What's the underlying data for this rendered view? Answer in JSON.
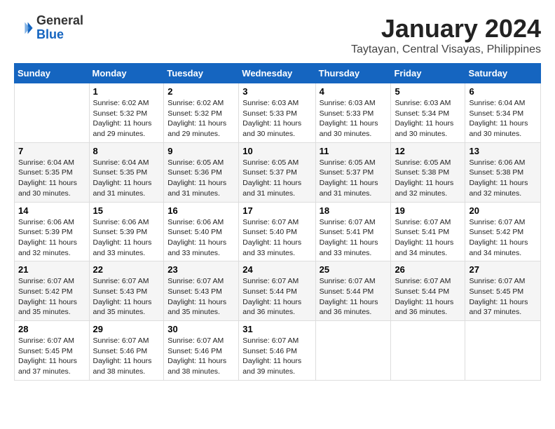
{
  "header": {
    "logo_general": "General",
    "logo_blue": "Blue",
    "month_title": "January 2024",
    "location": "Taytayan, Central Visayas, Philippines"
  },
  "days_of_week": [
    "Sunday",
    "Monday",
    "Tuesday",
    "Wednesday",
    "Thursday",
    "Friday",
    "Saturday"
  ],
  "weeks": [
    [
      {
        "day": "",
        "sunrise": "",
        "sunset": "",
        "daylight": ""
      },
      {
        "day": "1",
        "sunrise": "Sunrise: 6:02 AM",
        "sunset": "Sunset: 5:32 PM",
        "daylight": "Daylight: 11 hours and 29 minutes."
      },
      {
        "day": "2",
        "sunrise": "Sunrise: 6:02 AM",
        "sunset": "Sunset: 5:32 PM",
        "daylight": "Daylight: 11 hours and 29 minutes."
      },
      {
        "day": "3",
        "sunrise": "Sunrise: 6:03 AM",
        "sunset": "Sunset: 5:33 PM",
        "daylight": "Daylight: 11 hours and 30 minutes."
      },
      {
        "day": "4",
        "sunrise": "Sunrise: 6:03 AM",
        "sunset": "Sunset: 5:33 PM",
        "daylight": "Daylight: 11 hours and 30 minutes."
      },
      {
        "day": "5",
        "sunrise": "Sunrise: 6:03 AM",
        "sunset": "Sunset: 5:34 PM",
        "daylight": "Daylight: 11 hours and 30 minutes."
      },
      {
        "day": "6",
        "sunrise": "Sunrise: 6:04 AM",
        "sunset": "Sunset: 5:34 PM",
        "daylight": "Daylight: 11 hours and 30 minutes."
      }
    ],
    [
      {
        "day": "7",
        "sunrise": "Sunrise: 6:04 AM",
        "sunset": "Sunset: 5:35 PM",
        "daylight": "Daylight: 11 hours and 30 minutes."
      },
      {
        "day": "8",
        "sunrise": "Sunrise: 6:04 AM",
        "sunset": "Sunset: 5:35 PM",
        "daylight": "Daylight: 11 hours and 31 minutes."
      },
      {
        "day": "9",
        "sunrise": "Sunrise: 6:05 AM",
        "sunset": "Sunset: 5:36 PM",
        "daylight": "Daylight: 11 hours and 31 minutes."
      },
      {
        "day": "10",
        "sunrise": "Sunrise: 6:05 AM",
        "sunset": "Sunset: 5:37 PM",
        "daylight": "Daylight: 11 hours and 31 minutes."
      },
      {
        "day": "11",
        "sunrise": "Sunrise: 6:05 AM",
        "sunset": "Sunset: 5:37 PM",
        "daylight": "Daylight: 11 hours and 31 minutes."
      },
      {
        "day": "12",
        "sunrise": "Sunrise: 6:05 AM",
        "sunset": "Sunset: 5:38 PM",
        "daylight": "Daylight: 11 hours and 32 minutes."
      },
      {
        "day": "13",
        "sunrise": "Sunrise: 6:06 AM",
        "sunset": "Sunset: 5:38 PM",
        "daylight": "Daylight: 11 hours and 32 minutes."
      }
    ],
    [
      {
        "day": "14",
        "sunrise": "Sunrise: 6:06 AM",
        "sunset": "Sunset: 5:39 PM",
        "daylight": "Daylight: 11 hours and 32 minutes."
      },
      {
        "day": "15",
        "sunrise": "Sunrise: 6:06 AM",
        "sunset": "Sunset: 5:39 PM",
        "daylight": "Daylight: 11 hours and 33 minutes."
      },
      {
        "day": "16",
        "sunrise": "Sunrise: 6:06 AM",
        "sunset": "Sunset: 5:40 PM",
        "daylight": "Daylight: 11 hours and 33 minutes."
      },
      {
        "day": "17",
        "sunrise": "Sunrise: 6:07 AM",
        "sunset": "Sunset: 5:40 PM",
        "daylight": "Daylight: 11 hours and 33 minutes."
      },
      {
        "day": "18",
        "sunrise": "Sunrise: 6:07 AM",
        "sunset": "Sunset: 5:41 PM",
        "daylight": "Daylight: 11 hours and 33 minutes."
      },
      {
        "day": "19",
        "sunrise": "Sunrise: 6:07 AM",
        "sunset": "Sunset: 5:41 PM",
        "daylight": "Daylight: 11 hours and 34 minutes."
      },
      {
        "day": "20",
        "sunrise": "Sunrise: 6:07 AM",
        "sunset": "Sunset: 5:42 PM",
        "daylight": "Daylight: 11 hours and 34 minutes."
      }
    ],
    [
      {
        "day": "21",
        "sunrise": "Sunrise: 6:07 AM",
        "sunset": "Sunset: 5:42 PM",
        "daylight": "Daylight: 11 hours and 35 minutes."
      },
      {
        "day": "22",
        "sunrise": "Sunrise: 6:07 AM",
        "sunset": "Sunset: 5:43 PM",
        "daylight": "Daylight: 11 hours and 35 minutes."
      },
      {
        "day": "23",
        "sunrise": "Sunrise: 6:07 AM",
        "sunset": "Sunset: 5:43 PM",
        "daylight": "Daylight: 11 hours and 35 minutes."
      },
      {
        "day": "24",
        "sunrise": "Sunrise: 6:07 AM",
        "sunset": "Sunset: 5:44 PM",
        "daylight": "Daylight: 11 hours and 36 minutes."
      },
      {
        "day": "25",
        "sunrise": "Sunrise: 6:07 AM",
        "sunset": "Sunset: 5:44 PM",
        "daylight": "Daylight: 11 hours and 36 minutes."
      },
      {
        "day": "26",
        "sunrise": "Sunrise: 6:07 AM",
        "sunset": "Sunset: 5:44 PM",
        "daylight": "Daylight: 11 hours and 36 minutes."
      },
      {
        "day": "27",
        "sunrise": "Sunrise: 6:07 AM",
        "sunset": "Sunset: 5:45 PM",
        "daylight": "Daylight: 11 hours and 37 minutes."
      }
    ],
    [
      {
        "day": "28",
        "sunrise": "Sunrise: 6:07 AM",
        "sunset": "Sunset: 5:45 PM",
        "daylight": "Daylight: 11 hours and 37 minutes."
      },
      {
        "day": "29",
        "sunrise": "Sunrise: 6:07 AM",
        "sunset": "Sunset: 5:46 PM",
        "daylight": "Daylight: 11 hours and 38 minutes."
      },
      {
        "day": "30",
        "sunrise": "Sunrise: 6:07 AM",
        "sunset": "Sunset: 5:46 PM",
        "daylight": "Daylight: 11 hours and 38 minutes."
      },
      {
        "day": "31",
        "sunrise": "Sunrise: 6:07 AM",
        "sunset": "Sunset: 5:46 PM",
        "daylight": "Daylight: 11 hours and 39 minutes."
      },
      {
        "day": "",
        "sunrise": "",
        "sunset": "",
        "daylight": ""
      },
      {
        "day": "",
        "sunrise": "",
        "sunset": "",
        "daylight": ""
      },
      {
        "day": "",
        "sunrise": "",
        "sunset": "",
        "daylight": ""
      }
    ]
  ]
}
